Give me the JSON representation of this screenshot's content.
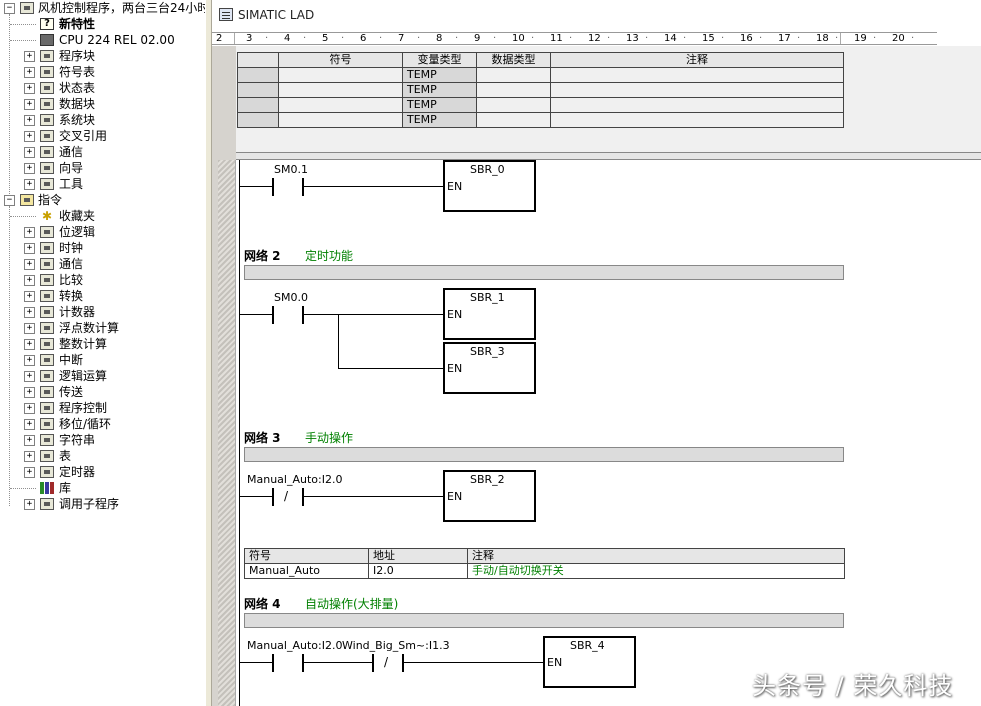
{
  "tree": {
    "root_label": "风机控制程序，两台三台24小时",
    "items": [
      {
        "label": "新特性",
        "bold": true
      },
      {
        "label": "CPU 224 REL 02.00"
      },
      {
        "label": "程序块"
      },
      {
        "label": "符号表"
      },
      {
        "label": "状态表"
      },
      {
        "label": "数据块"
      },
      {
        "label": "系统块"
      },
      {
        "label": "交叉引用"
      },
      {
        "label": "通信"
      },
      {
        "label": "向导"
      },
      {
        "label": "工具"
      }
    ],
    "instructions_label": "指令",
    "instruction_items": [
      {
        "label": "收藏夹"
      },
      {
        "label": "位逻辑"
      },
      {
        "label": "时钟"
      },
      {
        "label": "通信"
      },
      {
        "label": "比较"
      },
      {
        "label": "转换"
      },
      {
        "label": "计数器"
      },
      {
        "label": "浮点数计算"
      },
      {
        "label": "整数计算"
      },
      {
        "label": "中断"
      },
      {
        "label": "逻辑运算"
      },
      {
        "label": "传送"
      },
      {
        "label": "程序控制"
      },
      {
        "label": "移位/循环"
      },
      {
        "label": "字符串"
      },
      {
        "label": "表"
      },
      {
        "label": "定时器"
      },
      {
        "label": "库"
      },
      {
        "label": "调用子程序"
      }
    ]
  },
  "editor": {
    "title": "SIMATIC LAD",
    "ruler": [
      "2",
      "3",
      "4",
      "5",
      "6",
      "7",
      "8",
      "9",
      "10",
      "11",
      "12",
      "13",
      "14",
      "15",
      "16",
      "17",
      "18",
      "19",
      "20"
    ],
    "var_table": {
      "headers": [
        "符号",
        "变量类型",
        "数据类型",
        "注释"
      ],
      "rows": [
        "TEMP",
        "TEMP",
        "TEMP",
        "TEMP"
      ]
    },
    "network1": {
      "contact": "SM0.1",
      "box": "SBR_0",
      "en": "EN"
    },
    "network2": {
      "title": "网络 2",
      "comment": "定时功能",
      "contact": "SM0.0",
      "box1": "SBR_1",
      "box2": "SBR_3",
      "en": "EN"
    },
    "network3": {
      "title": "网络 3",
      "comment": "手动操作",
      "contact": "Manual_Auto:I2.0",
      "box": "SBR_2",
      "en": "EN",
      "symbol_table": {
        "headers": [
          "符号",
          "地址",
          "注释"
        ],
        "row": {
          "symbol": "Manual_Auto",
          "address": "I2.0",
          "comment": "手动/自动切换开关"
        }
      }
    },
    "network4": {
      "title": "网络 4",
      "comment": "自动操作(大排量)",
      "contact1": "Manual_Auto:I2.0",
      "contact2": "Wind_Big_Sm~:I1.3",
      "box": "SBR_4",
      "en": "EN"
    }
  },
  "watermark": "头条号 / 荣久科技"
}
